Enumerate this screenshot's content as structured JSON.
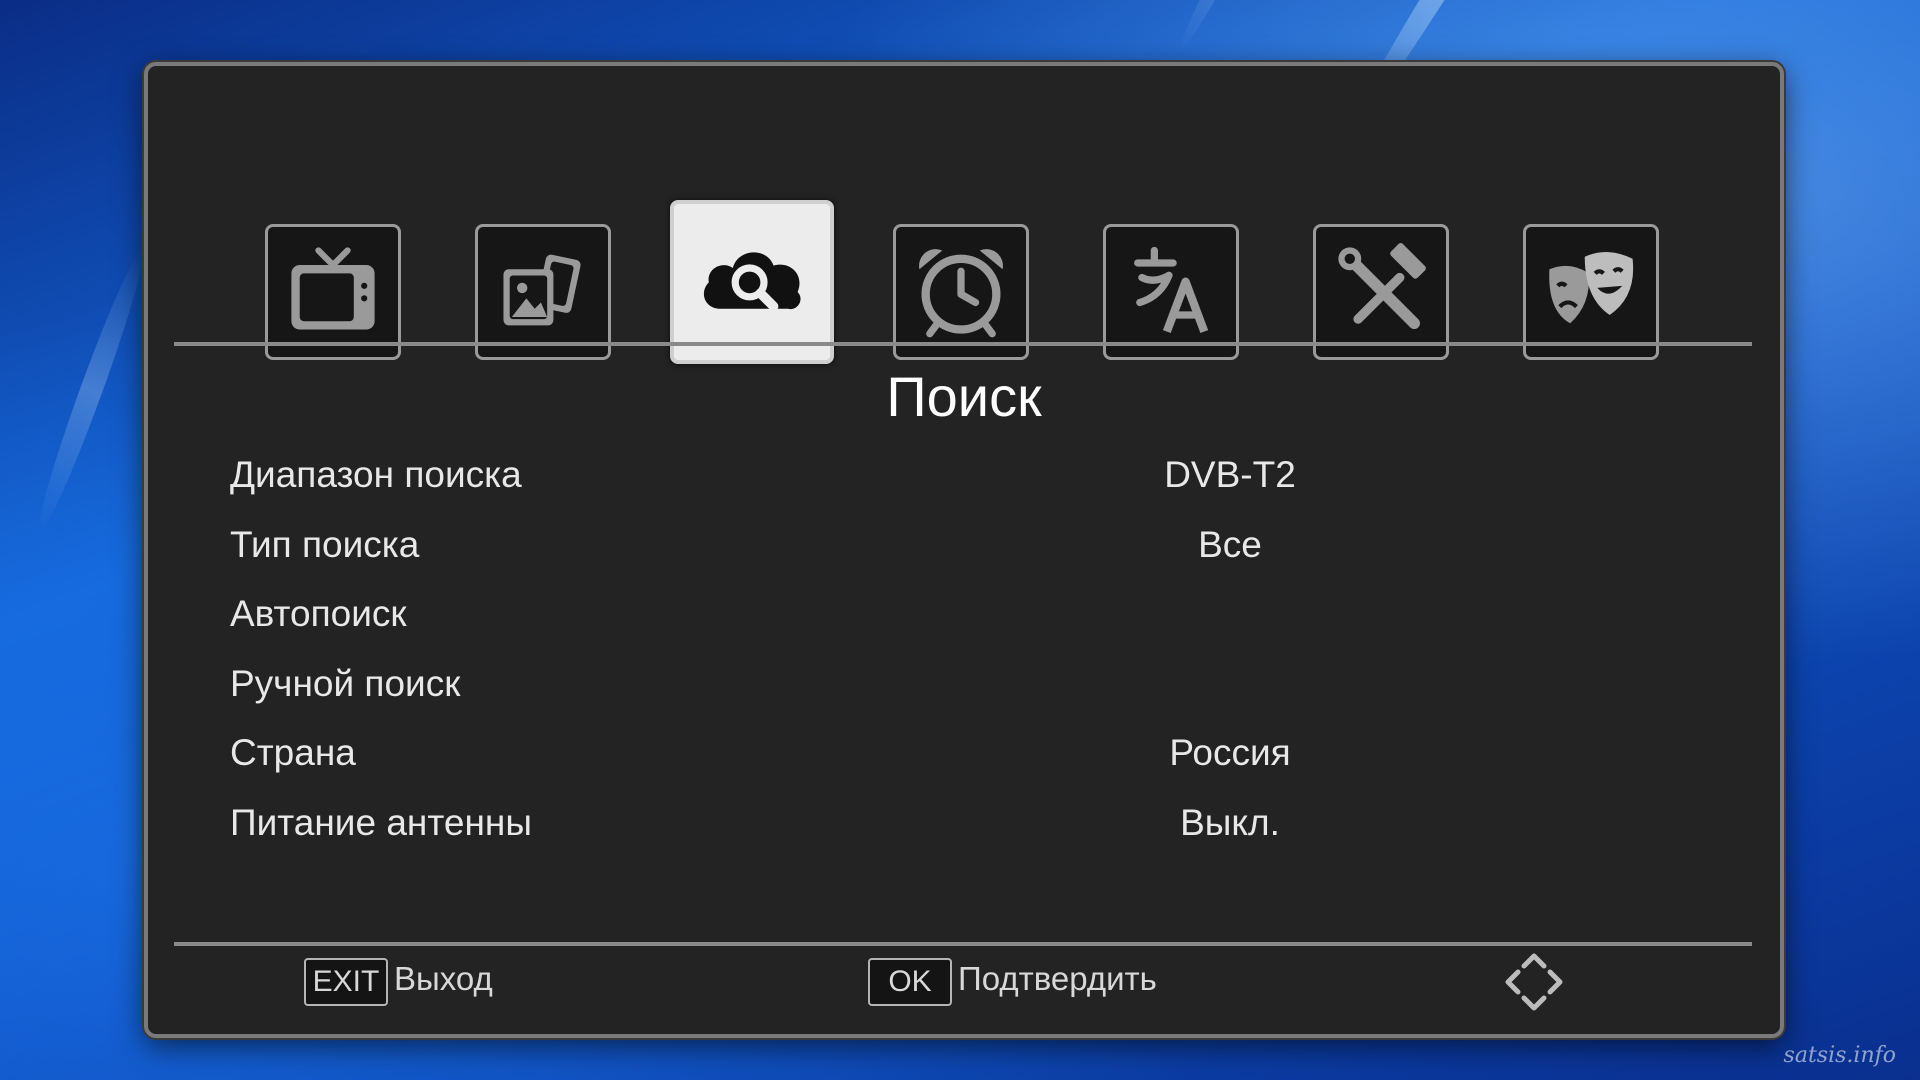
{
  "tabs": [
    {
      "icon": "tv-icon"
    },
    {
      "icon": "media-gallery-icon"
    },
    {
      "icon": "cloud-search-icon",
      "selected": true
    },
    {
      "icon": "alarm-clock-icon"
    },
    {
      "icon": "language-icon"
    },
    {
      "icon": "tools-icon"
    },
    {
      "icon": "theater-masks-icon"
    }
  ],
  "screen": {
    "title": "Поиск"
  },
  "menu": {
    "items": [
      {
        "label": "Диапазон поиска",
        "value": "DVB-T2"
      },
      {
        "label": "Тип поиска",
        "value": "Все"
      },
      {
        "label": "Автопоиск",
        "value": ""
      },
      {
        "label": "Ручной поиск",
        "value": ""
      },
      {
        "label": "Страна",
        "value": "Россия"
      },
      {
        "label": "Питание антенны",
        "value": "Выкл."
      }
    ]
  },
  "footer": {
    "exit_key": "EXIT",
    "exit_label": "Выход",
    "ok_key": "OK",
    "ok_label": "Подтвердить",
    "nav_icon": "navigation-arrows-icon"
  },
  "watermark": "satsis.info",
  "colors": {
    "panel_bg": "#232323",
    "tile_bg": "#161616",
    "selected_tile_bg": "#ececec",
    "text": "#e8e8e8"
  }
}
